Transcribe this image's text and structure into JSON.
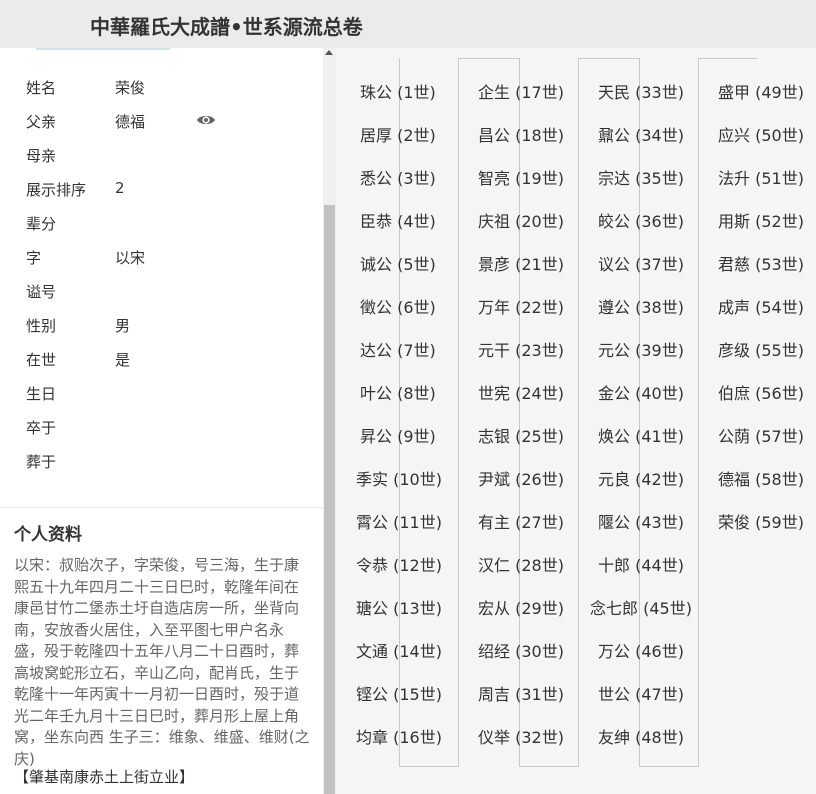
{
  "app": {
    "title": "中華羅氏大成譜•世系源流总卷"
  },
  "profile": {
    "fields": [
      {
        "label": "姓名",
        "value": "荣俊"
      },
      {
        "label": "父亲",
        "value": "德福"
      },
      {
        "label": "母亲",
        "value": ""
      },
      {
        "label": "展示排序",
        "value": "2"
      },
      {
        "label": "辈分",
        "value": ""
      },
      {
        "label": "字",
        "value": "以宋"
      },
      {
        "label": "谥号",
        "value": ""
      },
      {
        "label": "性别",
        "value": "男"
      },
      {
        "label": "在世",
        "value": "是"
      },
      {
        "label": "生日",
        "value": ""
      },
      {
        "label": "卒于",
        "value": ""
      },
      {
        "label": "葬于",
        "value": ""
      }
    ],
    "eye_icon": "eye-icon"
  },
  "bio": {
    "title": "个人资料",
    "text": "以宋：叔贻次子，字荣俊，号三海，生于康熙五十九年四月二十三日巳时，乾隆年间在康邑甘竹二堡赤土圩自造店房一所，坐背向南，安放香火居住，入至平图七甲户名永盛，殁于乾隆四十五年八月二十日酉时，葬高坡窝蛇形立石，辛山乙向，配肖氏，生于乾隆十一年丙寅十一月初一日酉时，殁于道光二年壬九月十三日巳时，葬月形上屋上角窝，坐东向西 生子三：维象、维盛、维财(之庆)",
    "footer": "【肇基南康赤土上街立业】"
  },
  "lineage": {
    "columns": [
      [
        "珠公 (1世)",
        "居厚 (2世)",
        "悉公 (3世)",
        "臣恭 (4世)",
        "诚公 (5世)",
        "徵公 (6世)",
        "达公 (7世)",
        "叶公 (8世)",
        "昇公 (9世)",
        "季实 (10世)",
        "霄公 (11世)",
        "令恭 (12世)",
        "瑭公 (13世)",
        "文通 (14世)",
        "铿公 (15世)",
        "均章 (16世)"
      ],
      [
        "企生 (17世)",
        "昌公 (18世)",
        "智亮 (19世)",
        "庆祖 (20世)",
        "景彦 (21世)",
        "万年 (22世)",
        "元干 (23世)",
        "世宪 (24世)",
        "志银 (25世)",
        "尹斌 (26世)",
        "有主 (27世)",
        "汉仁 (28世)",
        "宏从 (29世)",
        "绍经 (30世)",
        "周吉 (31世)",
        "仪举 (32世)"
      ],
      [
        "天民 (33世)",
        "鼐公 (34世)",
        "宗达 (35世)",
        "皎公 (36世)",
        "议公 (37世)",
        "遵公 (38世)",
        "元公 (39世)",
        "金公 (40世)",
        "焕公 (41世)",
        "元良 (42世)",
        "隁公 (43世)",
        "十郎 (44世)",
        "念七郎 (45世)",
        "万公 (46世)",
        "世公 (47世)",
        "友绅 (48世)"
      ],
      [
        "盛甲 (49世)",
        "应兴 (50世)",
        "法升 (51世)",
        "用斯 (52世)",
        "君慈 (53世)",
        "成声 (54世)",
        "彦级 (55世)",
        "伯庶 (56世)",
        "公荫 (57世)",
        "德福 (58世)",
        "荣俊 (59世)"
      ]
    ]
  }
}
